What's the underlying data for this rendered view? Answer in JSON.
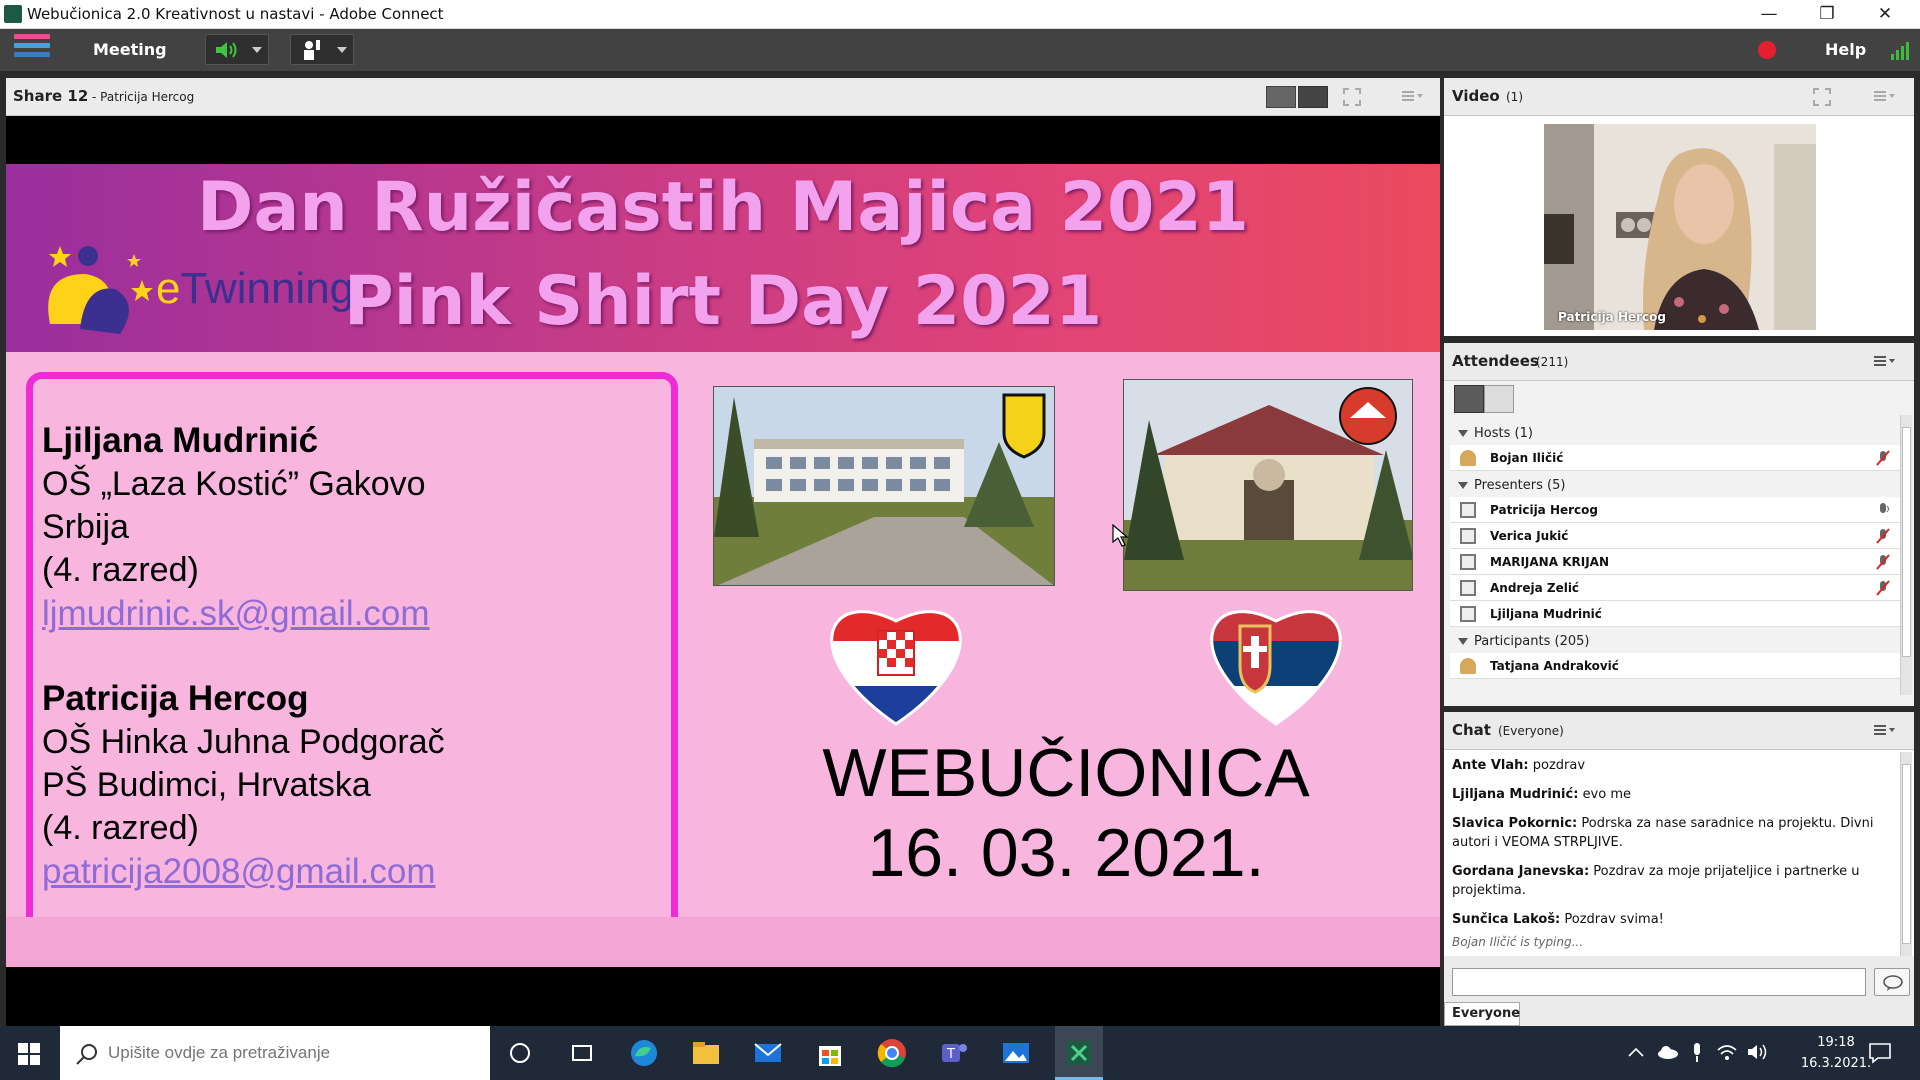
{
  "window": {
    "title": "Webučionica 2.0 Kreativnost u nastavi - Adobe Connect",
    "minimize": "—",
    "restore": "❐",
    "close": "✕"
  },
  "toolbar": {
    "meeting_label": "Meeting",
    "help_label": "Help",
    "record_color": "#e5202e",
    "signal_color": "#3dbb3d"
  },
  "share_pod": {
    "title": "Share 12",
    "presenter": "- Patricija Hercog"
  },
  "slide": {
    "title_line1": "Dan Ružičastih Majica 2021",
    "title_line2": "Pink Shirt Day 2021",
    "etwinning_e": "e",
    "etwinning_rest": "Twinning",
    "person1": {
      "name": "Ljiljana Mudrinić",
      "school": "OŠ „Laza Kostić” Gakovo",
      "country": "Srbija",
      "grade": "(4. razred)",
      "email": "ljmudrinic.sk@gmail.com"
    },
    "person2": {
      "name": "Patricija Hercog",
      "school": "OŠ Hinka Juhna Podgorač",
      "branch": "PŠ Budimci, Hrvatska",
      "grade": "(4. razred)",
      "email": "patricija2008@gmail.com"
    },
    "event_name": "WEBUČIONICA",
    "event_date": "16. 03. 2021."
  },
  "video_pod": {
    "title": "Video",
    "count": "(1)",
    "camera_name": "Patricija Hercog"
  },
  "attendees_pod": {
    "title": "Attendees",
    "count": "(211)",
    "hosts_label": "Hosts (1)",
    "hosts": [
      "Bojan Iličić"
    ],
    "presenters_label": "Presenters (5)",
    "presenters": [
      "Patricija Hercog",
      "Verica Jukić",
      "MARIJANA KRIJAN",
      "Andreja Zelić",
      "Ljiljana Mudrinić"
    ],
    "participants_label": "Participants (205)",
    "participants": [
      "Tatjana Andraković"
    ]
  },
  "chat_pod": {
    "title": "Chat",
    "scope": "(Everyone)",
    "messages": [
      {
        "author": "Ante Vlah:",
        "text": "pozdrav"
      },
      {
        "author": "Ljiljana Mudrinić:",
        "text": "evo me"
      },
      {
        "author": "Slavica Pokornic:",
        "text": "Podrska za nase saradnice na projektu. Divni autori i VEOMA STRPLJIVE."
      },
      {
        "author": "Gordana Janevska:",
        "text": "Pozdrav za moje prijateljice i partnerke u projektima."
      },
      {
        "author": "Sunčica Lakoš:",
        "text": "Pozdrav svima!"
      }
    ],
    "typing": "Bojan Iličić is typing...",
    "input_value": "",
    "recipient_tab": "Everyone"
  },
  "taskbar": {
    "search_placeholder": "Upišite ovdje za pretraživanje",
    "time": "19:18",
    "date": "16.3.2021."
  }
}
